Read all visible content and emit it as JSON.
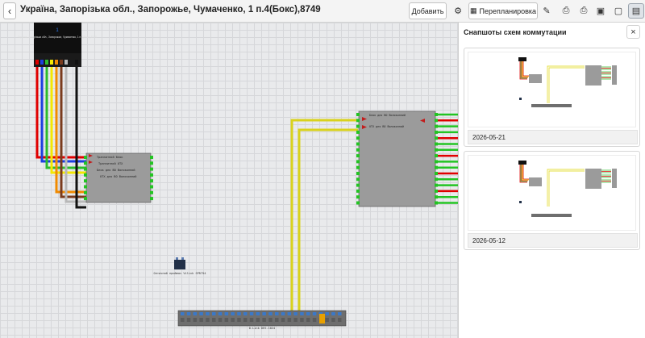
{
  "header": {
    "back_icon": "chevron-left-icon",
    "title": "Україна, Запорізька обл., Запорожье, Чумаченко, 1 п.4(Бокс),8749",
    "add_label": "Добавить",
    "settings_icon": "gears-icon",
    "replan_label": "Перепланировка",
    "replan_icon": "layout-icon",
    "tools": [
      {
        "name": "edit-icon"
      },
      {
        "name": "print-icon"
      },
      {
        "name": "print-alt-icon"
      },
      {
        "name": "image-icon"
      },
      {
        "name": "image-alt-icon"
      },
      {
        "name": "snapshots-icon"
      }
    ]
  },
  "panel": {
    "title": "Снапшоты схем коммутации",
    "close_label": "×",
    "snapshots": [
      {
        "date": "2026-05-21"
      },
      {
        "date": "2026-05-12"
      }
    ]
  },
  "diagram": {
    "cable_label": "Україна, Запорізька обл., Запорожье, Чумаченко, 1 п.4(Бокс),8749",
    "cable_count": "1",
    "splitter_a": {
      "rows": [
        "Транзитний блок",
        "Транзитний UTX",
        "Блок для ВО Волоконний",
        "UTX для ВО Волоконний"
      ]
    },
    "splitter_b": {
      "rows": [
        "Блок для ВО Волоконний",
        "UTX для ВО Волоконний"
      ]
    },
    "device_label": "Оптичний приймач Vilink SPR754",
    "switch_label": "D-Link DES-1024"
  },
  "colors": {
    "fibers": [
      "#e00000",
      "#1b3fe0",
      "#2cbc2c",
      "#f4e800",
      "#f08a00",
      "#7a3b1d",
      "#b8b8b8",
      "#111111"
    ],
    "port_green": "#23c423",
    "module_gray": "#9b9b9b",
    "trunk_yellow": "#d9d21d"
  }
}
